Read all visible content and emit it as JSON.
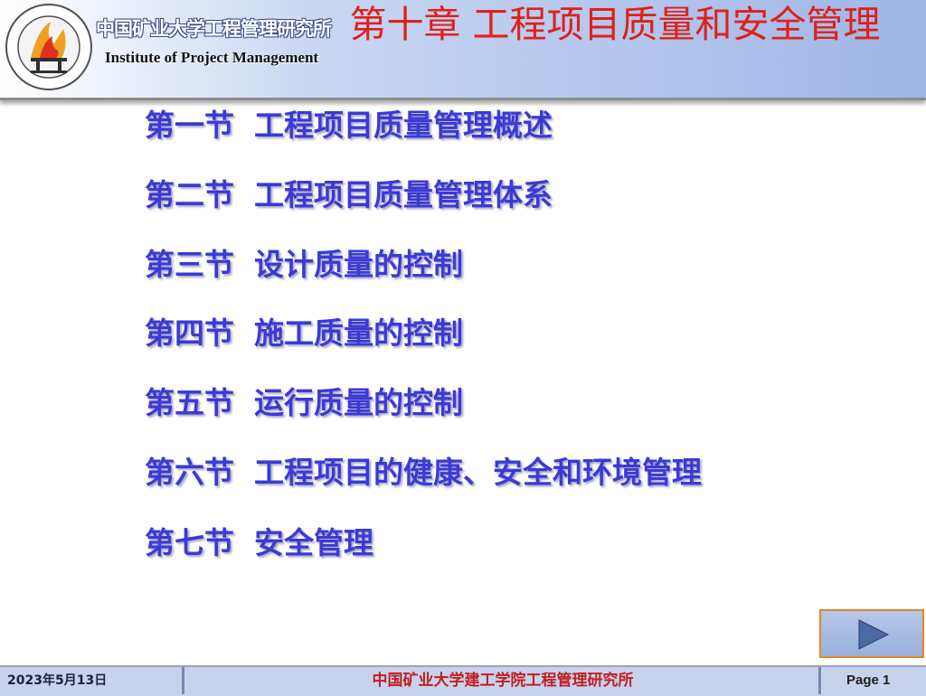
{
  "header": {
    "institute_cn": "中国矿业大学工程管理研究所",
    "institute_en": "Institute of Project Management",
    "chapter_title": "第十章 工程项目质量和安全管理"
  },
  "sections": [
    {
      "num": "第一节",
      "title": "工程项目质量管理概述"
    },
    {
      "num": "第二节",
      "title": "工程项目质量管理体系"
    },
    {
      "num": "第三节",
      "title": "设计质量的控制"
    },
    {
      "num": "第四节",
      "title": "施工质量的控制"
    },
    {
      "num": "第五节",
      "title": "运行质量的控制"
    },
    {
      "num": "第六节",
      "title": "工程项目的健康、安全和环境管理"
    },
    {
      "num": "第七节",
      "title": "安全管理"
    }
  ],
  "nav": {
    "icon": "play-triangle-icon"
  },
  "footer": {
    "date": "2023年5月13日",
    "center": "中国矿业大学建工学院工程管理研究所",
    "page": "Page 1"
  },
  "colors": {
    "title_red": "#e0201a",
    "section_blue": "#3a3ad6",
    "header_blue": "#9fb6e6",
    "nav_border": "#e8862a"
  }
}
